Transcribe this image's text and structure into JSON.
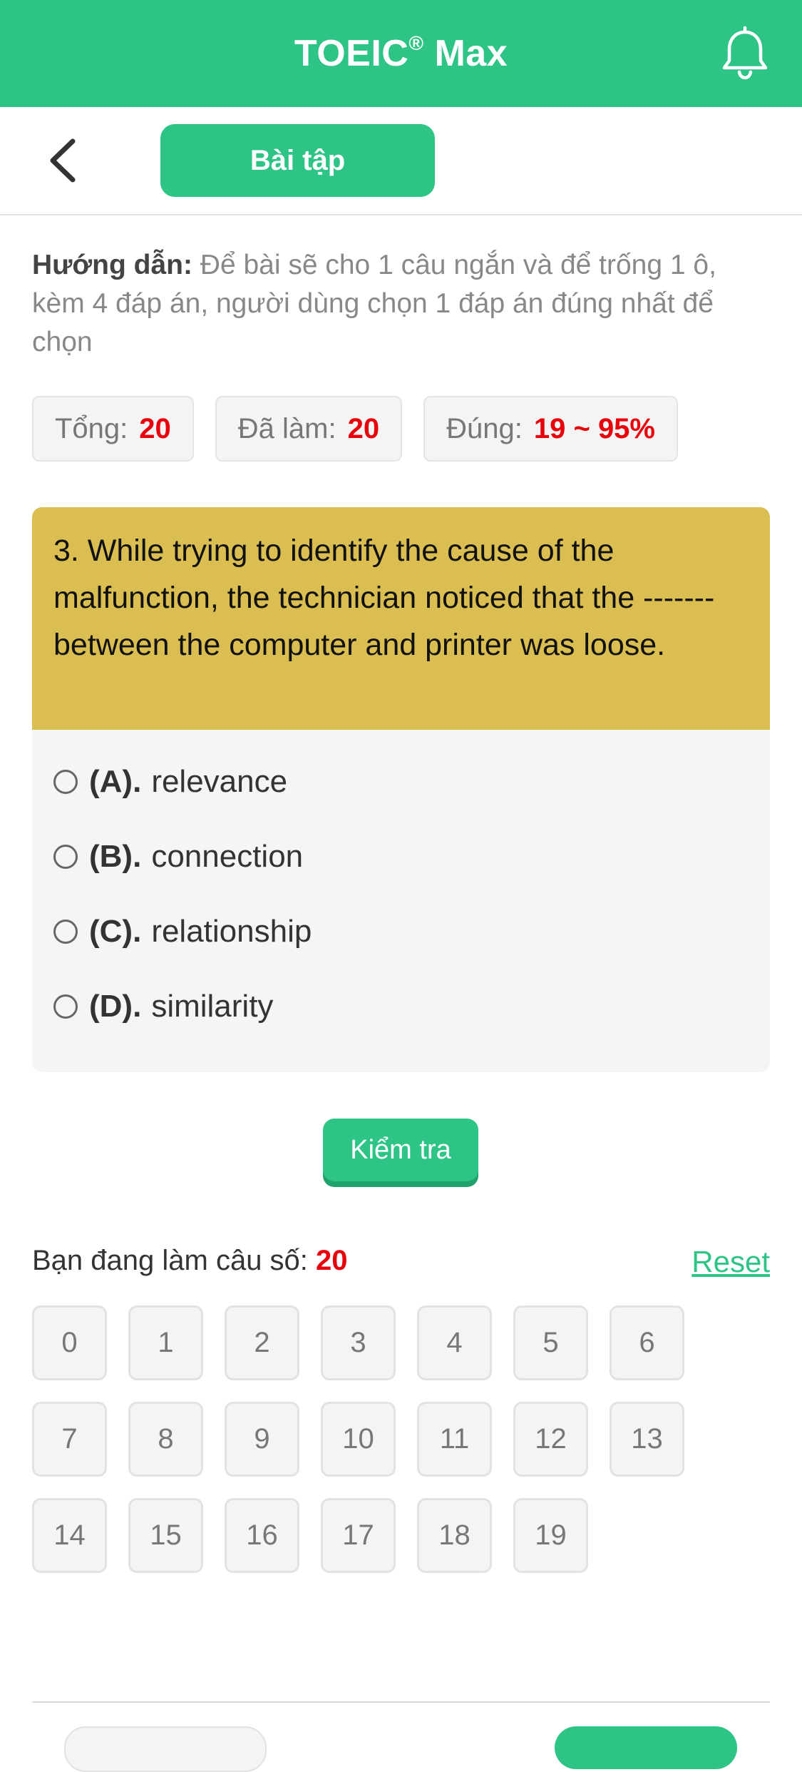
{
  "header": {
    "title": "TOEIC",
    "trademark": "®",
    "title_suffix": " Max",
    "bell_icon": "bell-icon"
  },
  "nav": {
    "back_icon": "chevron-left-icon",
    "tab_label": "Bài tập"
  },
  "instructions": {
    "label": "Hướng dẫn:",
    "text": " Để bài sẽ cho 1 câu ngắn và để trống 1 ô, kèm 4 đáp án, người dùng chọn 1 đáp án đúng nhất để chọn"
  },
  "stats": {
    "total_label": "Tổng:",
    "total_value": "20",
    "done_label": "Đã làm:",
    "done_value": "20",
    "correct_label": "Đúng:",
    "correct_value": "19 ~ 95%"
  },
  "question": {
    "text": "3. While trying to identify the cause of the malfunction, the technician noticed that the ------- between the computer and printer was loose.",
    "options": [
      {
        "letter": "(A).",
        "text": "relevance"
      },
      {
        "letter": "(B).",
        "text": "connection"
      },
      {
        "letter": "(C).",
        "text": "relationship"
      },
      {
        "letter": "(D).",
        "text": "similarity"
      }
    ]
  },
  "check_button": "Kiểm tra",
  "current": {
    "label": "Bạn đang làm câu số: ",
    "number": "20",
    "reset_label": "Reset"
  },
  "grid": {
    "numbers": [
      "0",
      "1",
      "2",
      "3",
      "4",
      "5",
      "6",
      "7",
      "8",
      "9",
      "10",
      "11",
      "12",
      "13",
      "14",
      "15",
      "16",
      "17",
      "18",
      "19"
    ]
  },
  "colors": {
    "brand_green": "#2ec486",
    "question_bg": "#dbbe52",
    "accent_red": "#e8000b"
  }
}
